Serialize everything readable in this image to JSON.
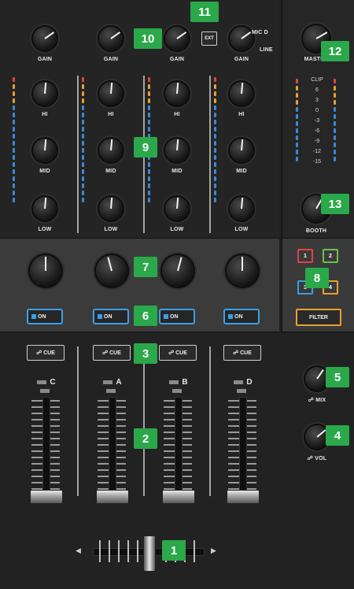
{
  "callouts": [
    "1",
    "2",
    "3",
    "4",
    "5",
    "6",
    "7",
    "8",
    "9",
    "10",
    "11",
    "12",
    "13"
  ],
  "labels": {
    "gain": "GAIN",
    "hi": "HI",
    "mid": "MID",
    "low": "LOW",
    "ext": "EXT",
    "mic": "MIC D",
    "line": "LINE",
    "master": "MASTER",
    "booth": "BOOTH",
    "on": "ON",
    "cue": "CUE",
    "mix": "MIX",
    "vol": "VOL",
    "filter": "FILTER"
  },
  "channels": [
    "C",
    "A",
    "B",
    "D"
  ],
  "fx_assign": [
    "1",
    "2",
    "3",
    "4"
  ],
  "master_vu": [
    "CLIP",
    "6",
    "3",
    "0",
    "-3",
    "-6",
    "-9",
    "-12",
    "-15"
  ],
  "colors": {
    "callout": "#2aa84a",
    "on_button": "#3aa0e8",
    "fx1": "#e04444",
    "fx2": "#6cc04a",
    "fx3": "#3aa0e8",
    "fx4": "#e8a030",
    "filter": "#e8a030"
  },
  "icons": {
    "headphone": "headphone-icon",
    "arrow_left": "arrow-left-icon",
    "arrow_right": "arrow-right-icon"
  }
}
